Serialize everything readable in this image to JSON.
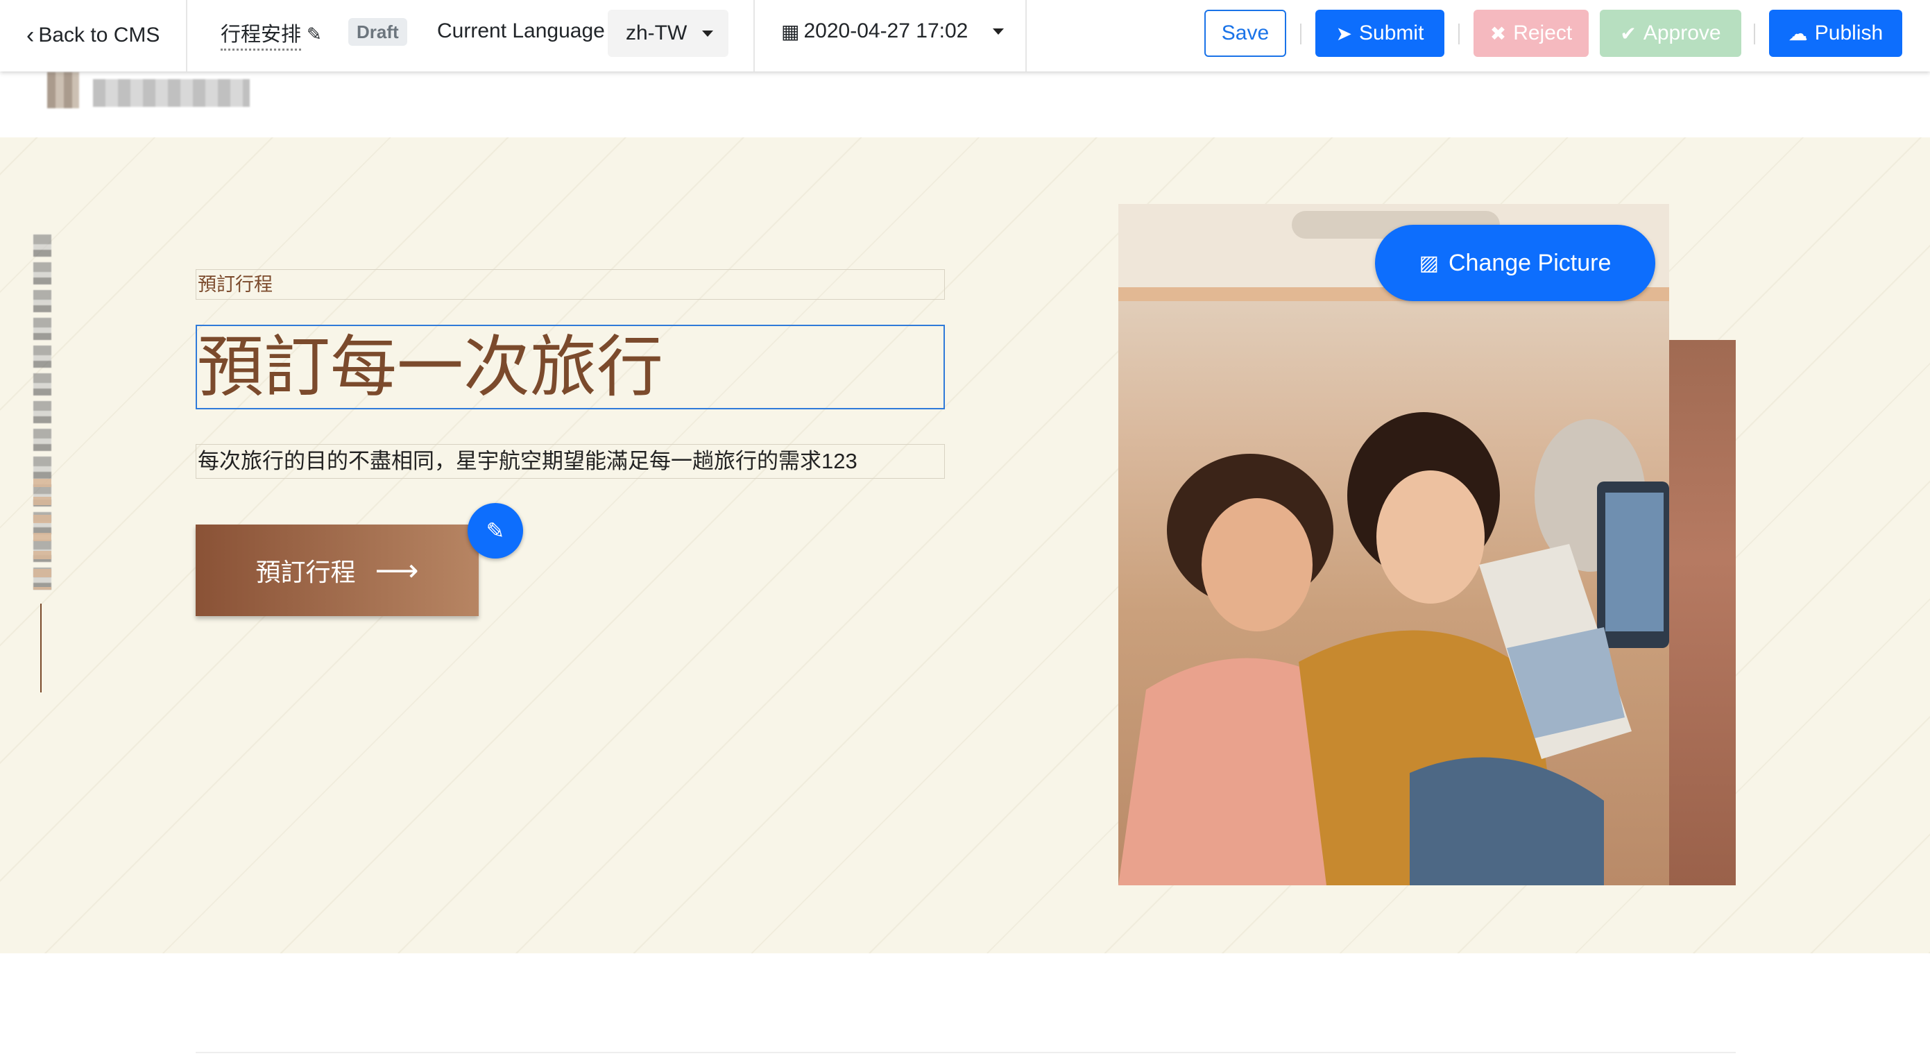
{
  "toolbar": {
    "back_label": "Back to CMS",
    "page_name": "行程安排",
    "status_badge": "Draft",
    "language_label": "Current Language",
    "language_value": "zh-TW",
    "datetime_value": "2020-04-27 17:02",
    "save_label": "Save",
    "submit_label": "Submit",
    "reject_label": "Reject",
    "approve_label": "Approve",
    "publish_label": "Publish",
    "icons": {
      "back": "chevron-left-icon",
      "edit_name": "pencil-icon",
      "language": "caret-down-icon",
      "date": "calendar-icon",
      "submit": "paper-plane-icon",
      "reject": "x-icon",
      "approve": "check-icon",
      "publish": "cloud-upload-icon"
    }
  },
  "hero": {
    "kicker": "預訂行程",
    "title": "預訂每一次旅行",
    "description": "每次旅行的目的不盡相同，星宇航空期望能滿足每一趟旅行的需求123",
    "cta_label": "預訂行程",
    "cta_arrow": "⟶",
    "change_picture_label": "Change Picture",
    "icons": {
      "edit_fab": "pencil-icon",
      "change_picture": "image-icon"
    }
  },
  "colors": {
    "primary": "#0d6efd",
    "brand_brown": "#7b4a2c",
    "hero_bg": "#f8f5e8",
    "reject_disabled": "#f5b9bf",
    "approve_disabled": "#b7dfc0"
  }
}
